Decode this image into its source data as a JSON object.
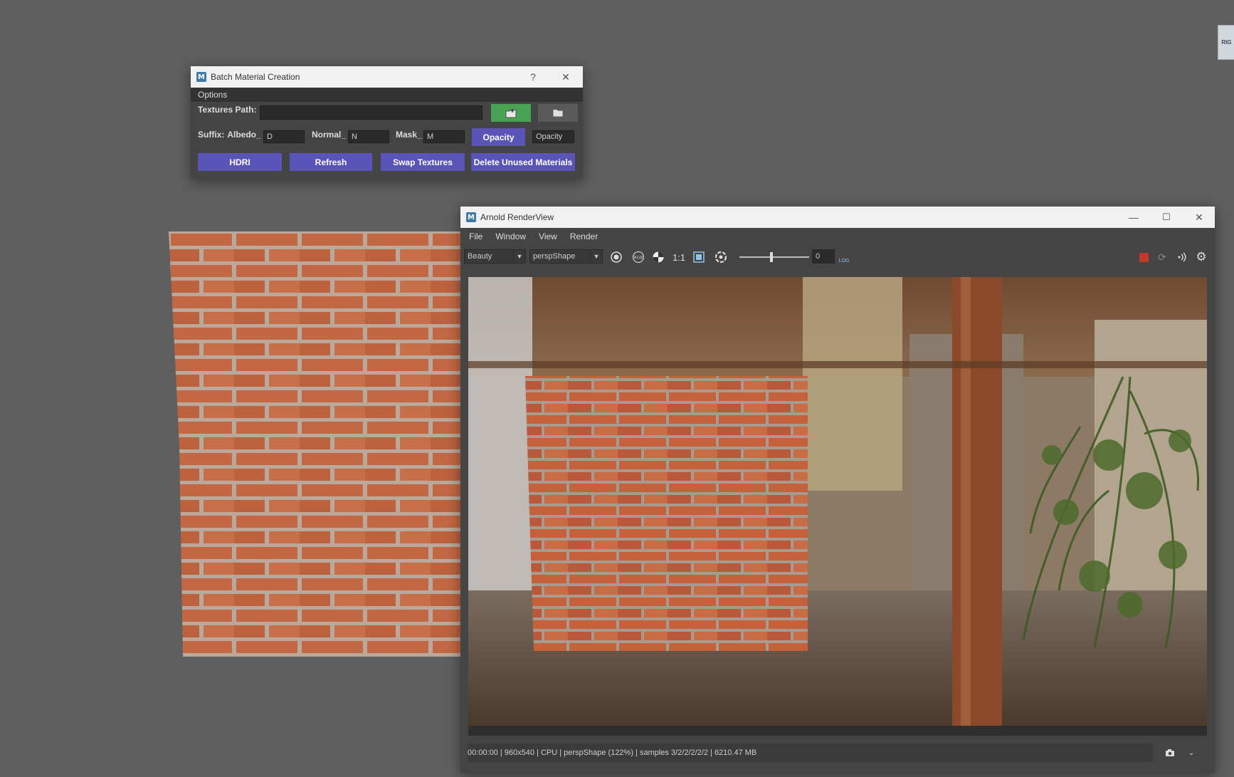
{
  "corner_tab": {
    "label": "RIG"
  },
  "batch_window": {
    "title": "Batch Material Creation",
    "help_label": "?",
    "menu": {
      "options": "Options"
    },
    "textures_path_label": "Textures Path:",
    "textures_path_value": "",
    "suffix_label": "Suffix:",
    "albedo_label": "Albedo_",
    "albedo_value": "D",
    "normal_label": "Normal_",
    "normal_value": "N",
    "mask_label": "Mask_",
    "mask_value": "M",
    "opacity_button": "Opacity",
    "opacity_value": "Opacity",
    "buttons": {
      "hdri": "HDRI",
      "refresh": "Refresh",
      "swap": "Swap Textures",
      "delete": "Delete Unused Materials"
    },
    "accent_color": "#5a54b9",
    "create_button_color": "#4aa354"
  },
  "render_view": {
    "title": "Arnold RenderView",
    "menu": [
      "File",
      "Window",
      "View",
      "Render"
    ],
    "aov_select": "Beauty",
    "camera_select": "perspShape",
    "zoom_label": "1:1",
    "exposure_value": "0",
    "log_label": "LOG",
    "status_text": "00:00:00 | 960x540 | CPU | perspShape (122%) | samples 3/2/2/2/2/2 | 6210.47 MB",
    "stop_color": "#c0392b"
  },
  "icons": [
    "maya-icon",
    "close-icon",
    "minimize-icon",
    "maximize-icon",
    "folder-icon",
    "folder-create-icon",
    "aperture-icon",
    "rgb-icon",
    "color-wheel-icon",
    "frame-icon",
    "refresh-icon",
    "stop-icon",
    "sound-icon",
    "gear-icon",
    "snapshot-icon",
    "chevron-down-icon"
  ]
}
